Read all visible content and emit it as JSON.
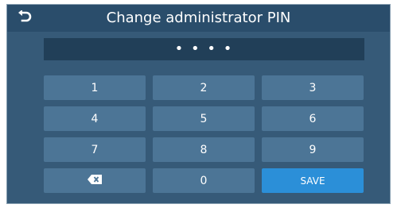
{
  "header": {
    "title": "Change administrator PIN",
    "back_icon": "back-arrow-icon"
  },
  "pin": {
    "masked_value": "• • • •"
  },
  "keypad": {
    "keys": [
      "1",
      "2",
      "3",
      "4",
      "5",
      "6",
      "7",
      "8",
      "9"
    ],
    "backspace_icon": "backspace-icon",
    "zero": "0",
    "save_label": "SAVE"
  },
  "colors": {
    "screen_bg": "#365a78",
    "header_bg": "#2a4d6b",
    "pin_bg": "#213f58",
    "key_bg": "#4c7596",
    "save_bg": "#2b8fd8"
  }
}
